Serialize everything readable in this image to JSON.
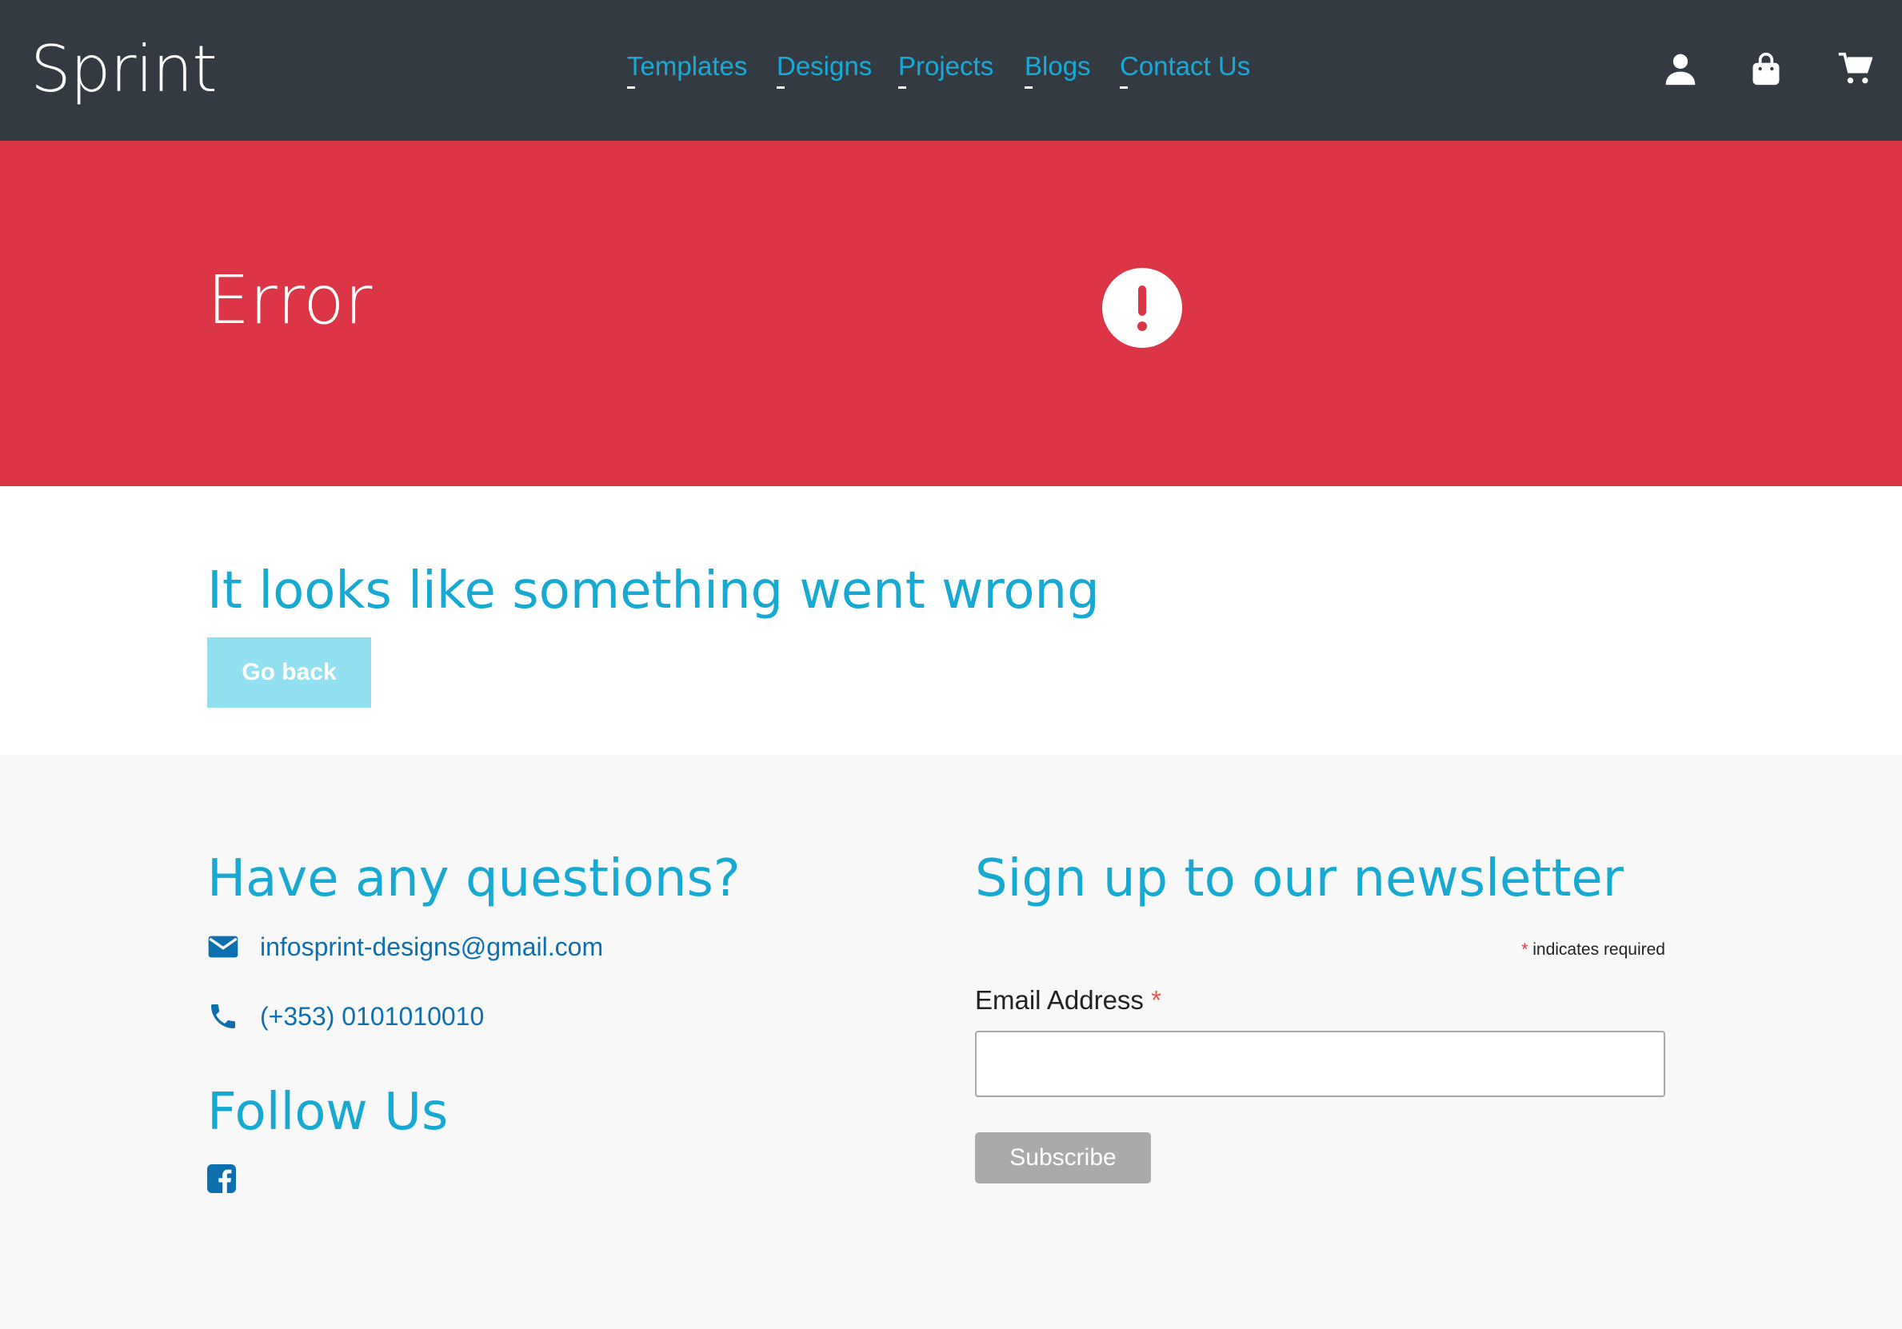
{
  "header": {
    "logo": "Sprint",
    "nav": [
      {
        "label": "Templates"
      },
      {
        "label": "Designs"
      },
      {
        "label": "Projects"
      },
      {
        "label": "Blogs"
      },
      {
        "label": "Contact Us"
      }
    ],
    "icons": [
      "user-icon",
      "shopping-bag-icon",
      "cart-icon"
    ]
  },
  "banner": {
    "title": "Error",
    "icon": "exclamation-circle-icon"
  },
  "message": {
    "title": "It looks like something went wrong",
    "back_label": "Go back"
  },
  "footer": {
    "questions_heading": "Have any questions?",
    "email": "infosprint-designs@gmail.com",
    "phone": "(+353) 0101010010",
    "follow_heading": "Follow Us",
    "newsletter_heading": "Sign up to our newsletter",
    "required_star": "*",
    "required_note": " indicates required",
    "email_label": "Email Address",
    "email_value": "",
    "subscribe_label": "Subscribe"
  },
  "colors": {
    "header_bg": "#343a42",
    "accent": "#17a9d1",
    "error_bg": "#dc3546",
    "footer_bg": "#f8f8f8",
    "link_blue": "#0e6fae",
    "button_disabled": "#aaaaaa"
  }
}
